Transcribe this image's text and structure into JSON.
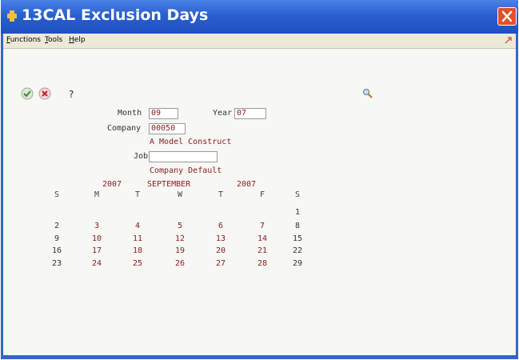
{
  "window": {
    "code": "13CAL",
    "title": "Exclusion Days"
  },
  "menu": [
    {
      "label": "Functions",
      "mnemonic": "F"
    },
    {
      "label": "Tools",
      "mnemonic": "T"
    },
    {
      "label": "Help",
      "mnemonic": "H"
    }
  ],
  "toolbar": {
    "help_label": "?"
  },
  "form": {
    "month_label": "Month",
    "month_value": "09",
    "year_label": "Year",
    "year_value": "07",
    "company_label": "Company",
    "company_value": "00050",
    "company_name": "A Model Construct",
    "job_label": "Job",
    "job_value": "",
    "job_desc": "Company Default"
  },
  "calendar": {
    "year_left": "2007",
    "month": "SEPTEMBER",
    "year_right": "2007",
    "days_of_week": [
      "S",
      "M",
      "T",
      "W",
      "T",
      "F",
      "S"
    ],
    "weeks": [
      [
        "",
        "",
        "",
        "",
        "",
        "",
        "1"
      ],
      [
        "2",
        "3",
        "4",
        "5",
        "6",
        "7",
        "8"
      ],
      [
        "9",
        "10",
        "11",
        "12",
        "13",
        "14",
        "15"
      ],
      [
        "16",
        "17",
        "18",
        "19",
        "20",
        "21",
        "22"
      ],
      [
        "23",
        "24",
        "25",
        "26",
        "27",
        "28",
        "29"
      ]
    ]
  },
  "colors": {
    "title_bar": "#2a5fd0",
    "field_text": "#8b1c1c",
    "close": "#e2502a"
  }
}
